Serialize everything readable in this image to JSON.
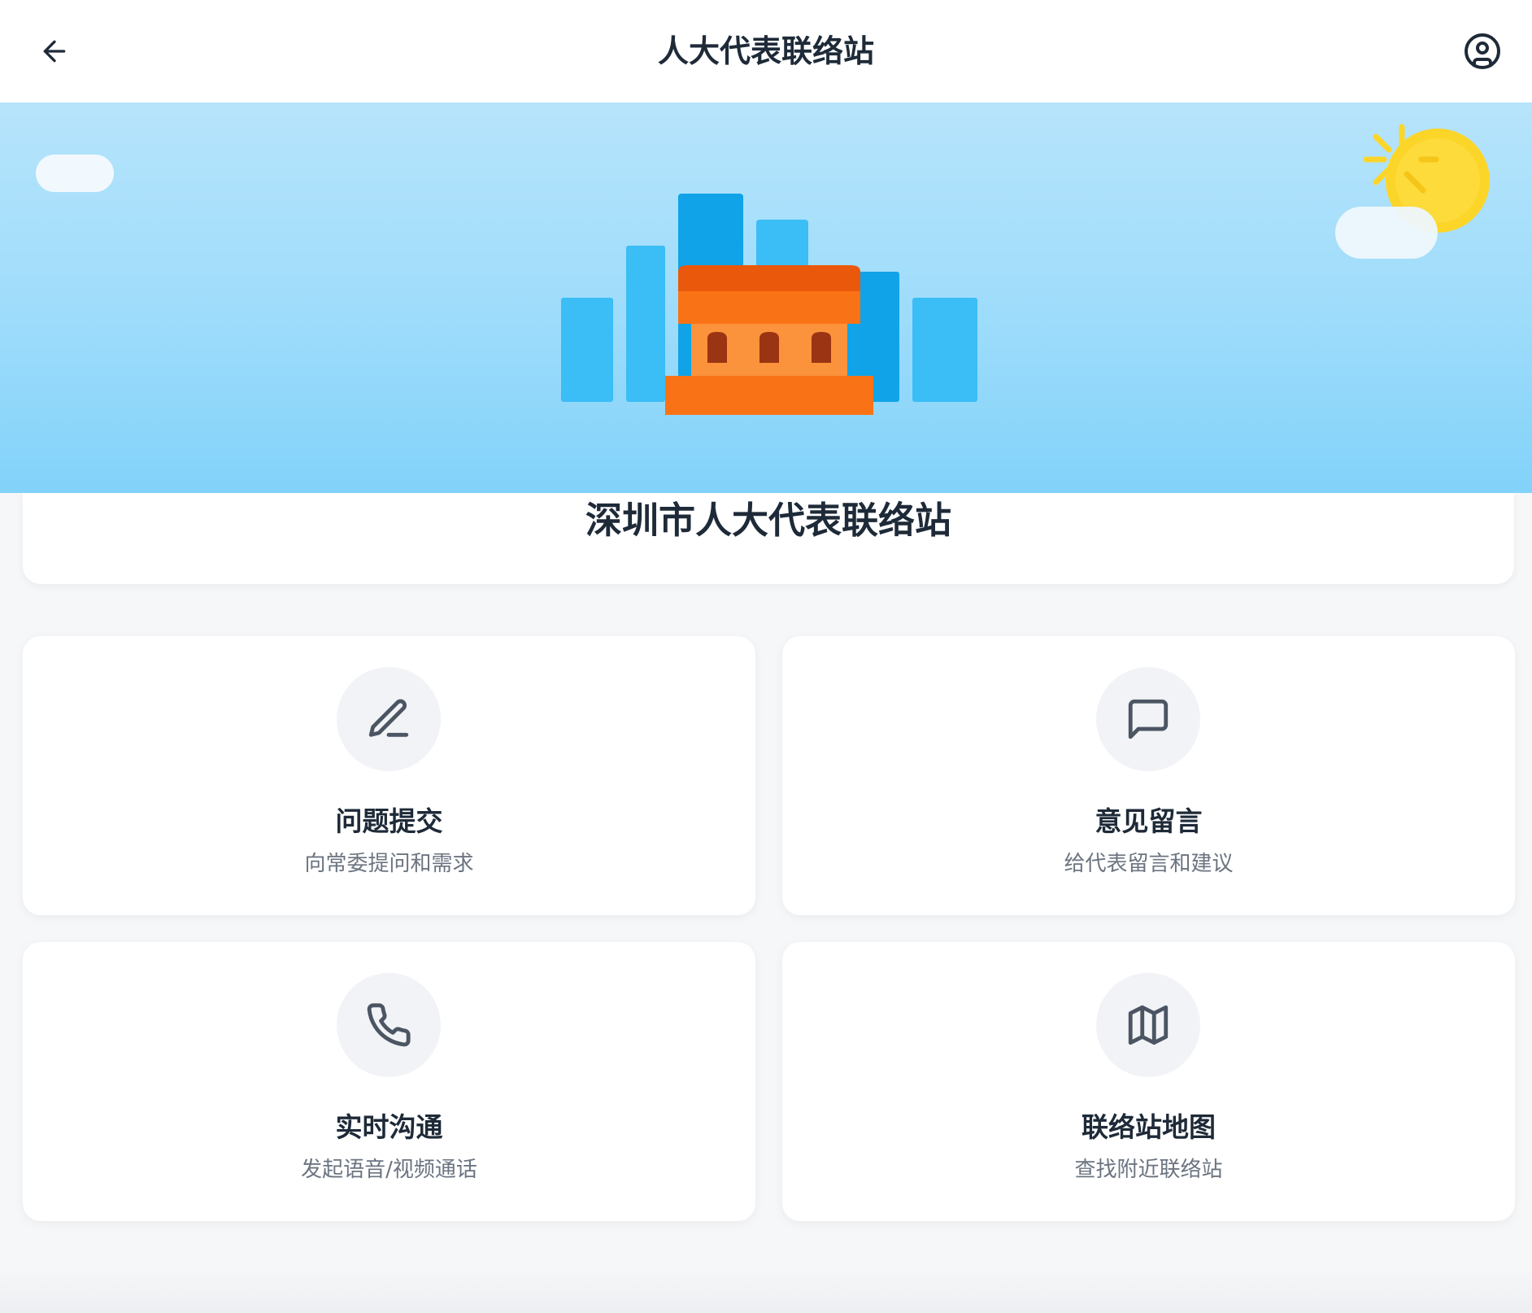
{
  "header": {
    "title": "人大代表联络站",
    "back_icon": "arrow-left-icon",
    "user_icon": "user-circle-icon"
  },
  "station": {
    "name": "深圳市人大代表联络站"
  },
  "features": [
    {
      "title": "问题提交",
      "description": "向常委提问和需求",
      "icon": "pencil-icon"
    },
    {
      "title": "意见留言",
      "description": "给代表留言和建议",
      "icon": "message-square-icon"
    },
    {
      "title": "实时沟通",
      "description": "发起语音/视频通话",
      "icon": "phone-icon"
    },
    {
      "title": "联络站地图",
      "description": "查找附近联络站",
      "icon": "map-icon"
    }
  ],
  "colors": {
    "sky_top": "#b6e4fb",
    "sky_bottom": "#82d2fa",
    "building_blue": "#3bbdf6",
    "building_blue_dark": "#10a3e8",
    "hall_orange": "#f97316",
    "hall_roof": "#ea580c",
    "sun": "#fcd529",
    "text_primary": "#1e2a38",
    "text_secondary": "#6b7480"
  }
}
